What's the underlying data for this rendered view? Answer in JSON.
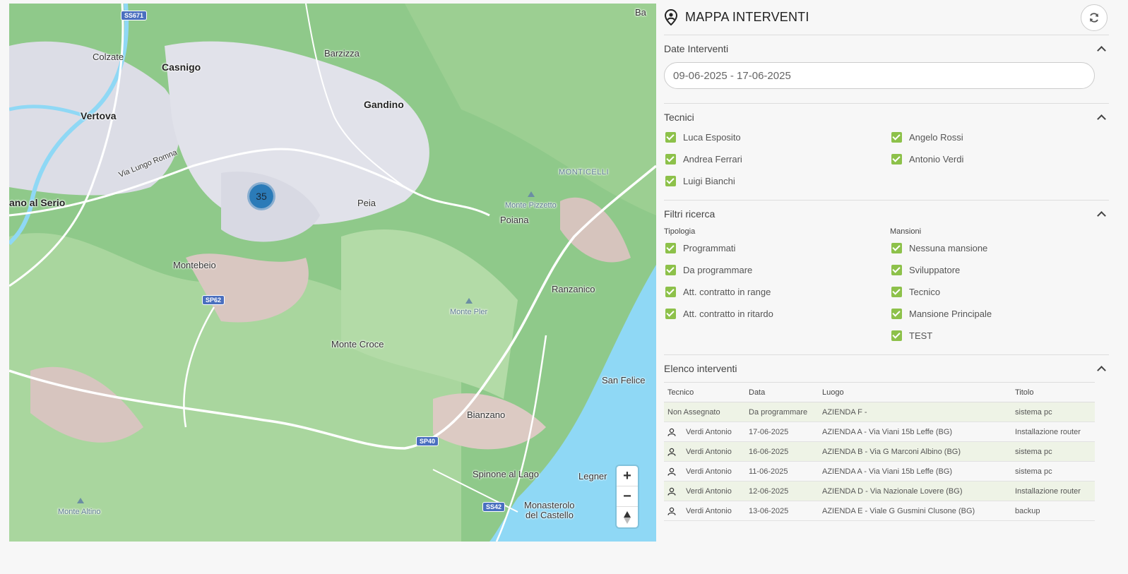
{
  "panel": {
    "title": "MAPPA INTERVENTI",
    "icon": "map-pin-person-icon",
    "refresh_icon": "refresh-icon"
  },
  "map": {
    "cluster_count": "35",
    "zoom_in": "+",
    "zoom_out": "−",
    "places": {
      "colzate": "Colzate",
      "casnigo": "Casnigo",
      "barzizza": "Barzizza",
      "vertova": "Vertova",
      "gandino": "Gandino",
      "via_lungo_romna": "Via Lungo Romna",
      "monticelli": "MONTICELLI",
      "ano_al_serio": "ano al Serio",
      "peia": "Peia",
      "monte_pizzetto": "Monte Pizzetto",
      "poiana": "Poiana",
      "montebeio": "Montebeio",
      "ranzanico": "Ranzanico",
      "monte_pler": "Monte Pler",
      "monte_croce": "Monte Croce",
      "san_felice": "San Felice",
      "bianzano": "Bianzano",
      "spinone": "Spinone al Lago",
      "legner": "Legner",
      "monasterolo_1": "Monasterolo",
      "monasterolo_2": "del Castello",
      "monte_altino": "Monte Altino",
      "ba": "Ba"
    },
    "shields": {
      "ss671": "SS671",
      "sp62": "SP62",
      "sp40": "SP40",
      "ss42": "SS42"
    }
  },
  "date_section": {
    "label": "Date Interventi",
    "value": "09-06-2025 - 17-06-2025"
  },
  "tecnici_section": {
    "label": "Tecnici",
    "items": [
      "Luca Esposito",
      "Angelo Rossi",
      "Andrea Ferrari",
      "Antonio Verdi",
      "Luigi Bianchi"
    ]
  },
  "filtri_section": {
    "label": "Filtri ricerca",
    "tipologia_label": "Tipologia",
    "tipologia": [
      "Programmati",
      "Da programmare",
      "Att. contratto in range",
      "Att. contratto in ritardo"
    ],
    "mansioni_label": "Mansioni",
    "mansioni": [
      "Nessuna mansione",
      "Sviluppatore",
      "Tecnico",
      "Mansione Principale",
      "TEST"
    ]
  },
  "elenco_section": {
    "label": "Elenco interventi",
    "columns": [
      "Tecnico",
      "Data",
      "Luogo",
      "Titolo"
    ],
    "rows": [
      {
        "tecnico": "Non Assegnato",
        "data": "Da programmare",
        "luogo": "AZIENDA F -",
        "titolo": "sistema pc"
      },
      {
        "tecnico": "Verdi Antonio",
        "data": "17-06-2025",
        "luogo": "AZIENDA A - Via Viani 15b Leffe (BG)",
        "titolo": "Installazione router"
      },
      {
        "tecnico": "Verdi Antonio",
        "data": "16-06-2025",
        "luogo": "AZIENDA B - Via G Marconi Albino (BG)",
        "titolo": "sistema pc"
      },
      {
        "tecnico": "Verdi Antonio",
        "data": "11-06-2025",
        "luogo": "AZIENDA A - Via Viani 15b Leffe (BG)",
        "titolo": "sistema pc"
      },
      {
        "tecnico": "Verdi Antonio",
        "data": "12-06-2025",
        "luogo": "AZIENDA D - Via Nazionale Lovere (BG)",
        "titolo": "Installazione router"
      },
      {
        "tecnico": "Verdi Antonio",
        "data": "13-06-2025",
        "luogo": "AZIENDA E - Viale G Gusmini Clusone (BG)",
        "titolo": "backup"
      }
    ]
  },
  "colors": {
    "checkbox": "#8dc14a",
    "cluster": "#2b7bb8",
    "lake": "#8fd8f5",
    "row_highlight": "#eef3e6"
  }
}
